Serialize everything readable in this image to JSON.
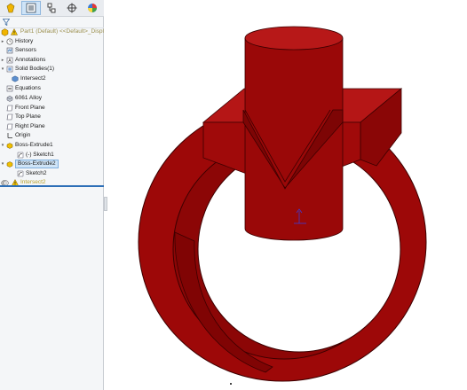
{
  "panel": {
    "tabs": [
      {
        "name": "feature-manager-tab",
        "icon": "feature-tree-icon",
        "active": false
      },
      {
        "name": "property-manager-tab",
        "icon": "property-list-icon",
        "active": true
      },
      {
        "name": "configuration-manager-tab",
        "icon": "configuration-icon",
        "active": false
      },
      {
        "name": "dimxpert-tab",
        "icon": "crosshair-icon",
        "active": false
      },
      {
        "name": "display-manager-tab",
        "icon": "color-wheel-icon",
        "active": false
      }
    ],
    "filter_icon": "funnel-icon"
  },
  "tree": {
    "part_label": "Part1 (Default) <<Default>_Displ",
    "history": "History",
    "sensors": "Sensors",
    "annotations": "Annotations",
    "solid_bodies": "Solid Bodies(1)",
    "intersect_body": "Intersect2",
    "equations": "Equations",
    "material": "6061 Alloy",
    "front_plane": "Front Plane",
    "top_plane": "Top Plane",
    "right_plane": "Right Plane",
    "origin": "Origin",
    "boss_extrude1": "Boss-Extrude1",
    "sketch1": "(-) Sketch1",
    "boss_extrude2": "Boss-Extrude2",
    "sketch2": "Sketch2",
    "intersect_feature": "Intersect2"
  },
  "colors": {
    "accent": "#2d6fb7",
    "model_front": "#a30b0b",
    "model_side": "#8a0606",
    "model_top": "#b81818",
    "model_edge": "#3c0000",
    "warning": "#e0b000"
  },
  "icons": {
    "history": "clock-icon",
    "sensors": "sensor-icon",
    "annotations": "annotation-icon",
    "solid_bodies": "solid-bodies-icon",
    "equations": "equation-icon",
    "material": "material-icon",
    "plane": "plane-icon",
    "origin": "origin-icon",
    "feature": "extrude-icon",
    "sketch": "sketch-icon",
    "warning": "warning-icon"
  }
}
